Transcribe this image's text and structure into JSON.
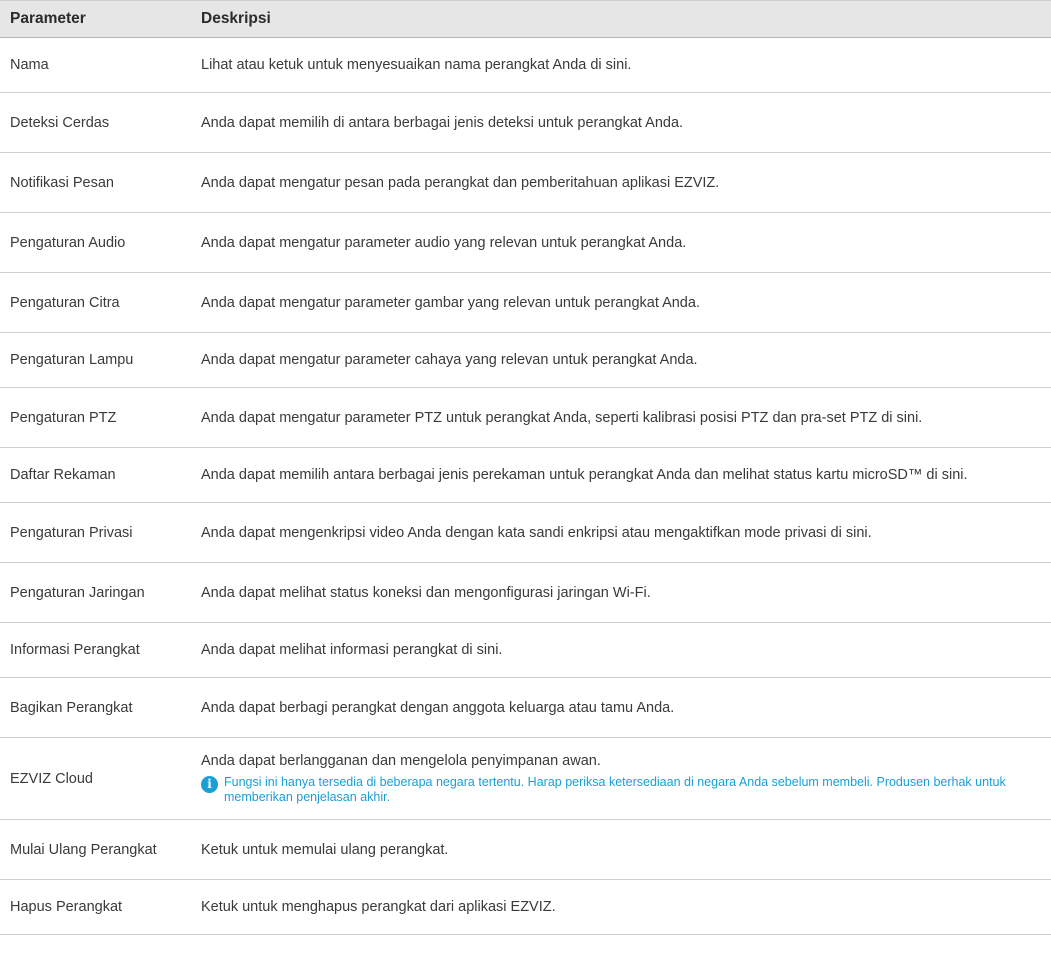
{
  "table": {
    "headers": [
      "Parameter",
      "Deskripsi"
    ],
    "rows": [
      {
        "param": "Nama",
        "desc": "Lihat atau ketuk untuk menyesuaikan nama perangkat Anda di sini."
      },
      {
        "param": "Deteksi Cerdas",
        "desc": "Anda dapat memilih di antara berbagai jenis deteksi untuk perangkat Anda."
      },
      {
        "param": "Notifikasi Pesan",
        "desc": "Anda dapat mengatur pesan pada perangkat dan pemberitahuan aplikasi EZVIZ."
      },
      {
        "param": "Pengaturan Audio",
        "desc": "Anda dapat mengatur parameter audio yang relevan untuk perangkat Anda."
      },
      {
        "param": "Pengaturan Citra",
        "desc": "Anda dapat mengatur parameter gambar yang relevan untuk perangkat Anda."
      },
      {
        "param": "Pengaturan Lampu",
        "desc": "Anda dapat mengatur parameter cahaya yang relevan untuk perangkat Anda."
      },
      {
        "param": "Pengaturan PTZ",
        "desc": "Anda dapat mengatur parameter PTZ untuk perangkat Anda, seperti kalibrasi posisi PTZ dan pra-set PTZ di sini."
      },
      {
        "param": "Daftar Rekaman",
        "desc": "Anda dapat memilih antara berbagai jenis perekaman untuk perangkat Anda dan melihat status kartu microSD™ di sini."
      },
      {
        "param": "Pengaturan Privasi",
        "desc": "Anda dapat mengenkripsi video Anda dengan kata sandi enkripsi atau mengaktifkan mode privasi di sini."
      },
      {
        "param": "Pengaturan Jaringan",
        "desc": "Anda dapat melihat status koneksi dan mengonfigurasi jaringan Wi-Fi."
      },
      {
        "param": "Informasi Perangkat",
        "desc": "Anda dapat melihat informasi perangkat di sini."
      },
      {
        "param": "Bagikan Perangkat",
        "desc": "Anda dapat berbagi perangkat dengan anggota keluarga atau tamu Anda."
      },
      {
        "param": "EZVIZ Cloud",
        "desc": "Anda dapat berlangganan dan mengelola penyimpanan awan.",
        "note": "Fungsi ini hanya tersedia di beberapa negara tertentu. Harap periksa ketersediaan di negara Anda sebelum membeli. Produsen berhak untuk memberikan penjelasan akhir."
      },
      {
        "param": "Mulai Ulang Perangkat",
        "desc": "Ketuk untuk memulai ulang perangkat."
      },
      {
        "param": "Hapus Perangkat",
        "desc": "Ketuk untuk menghapus perangkat dari aplikasi EZVIZ."
      }
    ]
  },
  "icons": {
    "note_icon": "info-icon",
    "note_icon_glyph": "i"
  },
  "colors": {
    "header_bg": "#e6e6e6",
    "note_blue": "#1a9fd6",
    "text": "#3a3a3a"
  }
}
